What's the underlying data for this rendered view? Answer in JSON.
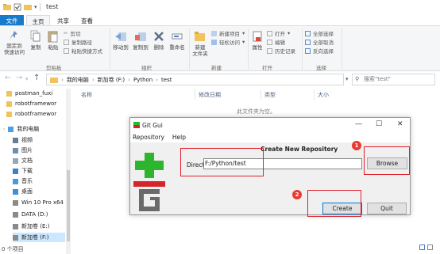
{
  "window": {
    "title": "test"
  },
  "ribbon_tabs": [
    "文件",
    "主页",
    "共享",
    "查看"
  ],
  "ribbon": {
    "clipboard": {
      "pin_label_1": "固定到",
      "pin_label_2": "快速访问",
      "copy": "复制",
      "paste": "粘贴",
      "cut": "剪切",
      "copy_path": "复制路径",
      "paste_shortcut": "粘贴快捷方式",
      "group": "剪贴板"
    },
    "organize": {
      "move_to": "移动到",
      "copy_to": "复制到",
      "delete": "删除",
      "rename": "重命名",
      "group": "组织"
    },
    "new": {
      "new_folder_1": "新建",
      "new_folder_2": "文件夹",
      "new_item": "新建项目",
      "easy_access": "轻松访问",
      "group": "新建"
    },
    "open": {
      "properties": "属性",
      "open": "打开",
      "edit": "编辑",
      "history": "历史记录",
      "group": "打开"
    },
    "select": {
      "select_all": "全部选择",
      "select_none": "全部取消",
      "invert": "反向选择",
      "group": "选择"
    }
  },
  "address": {
    "path": [
      "我的电脑",
      "新加卷 (F:)",
      "Python",
      "test"
    ],
    "search_placeholder": "搜索\"test\""
  },
  "nav": {
    "items": [
      {
        "label": "postman_fuxi",
        "icon": "folder-icon"
      },
      {
        "label": "robotframewor",
        "icon": "folder-icon"
      },
      {
        "label": "robotframewor",
        "icon": "folder-icon"
      },
      {
        "label": "我的电脑",
        "icon": "computer-icon"
      },
      {
        "label": "视频",
        "icon": "video-icon"
      },
      {
        "label": "图片",
        "icon": "pictures-icon"
      },
      {
        "label": "文档",
        "icon": "documents-icon"
      },
      {
        "label": "下载",
        "icon": "download-icon"
      },
      {
        "label": "音乐",
        "icon": "music-icon"
      },
      {
        "label": "桌面",
        "icon": "desktop-icon"
      },
      {
        "label": "Win 10 Pro x64",
        "icon": "drive-icon"
      },
      {
        "label": "DATA (D:)",
        "icon": "drive-icon"
      },
      {
        "label": "新加卷 (E:)",
        "icon": "drive-icon"
      },
      {
        "label": "新加卷 (F:)",
        "icon": "drive-icon"
      }
    ]
  },
  "columns": [
    "名称",
    "修改日期",
    "类型",
    "大小"
  ],
  "empty_message": "此文件夹为空。",
  "status": "0 个项目",
  "git_gui": {
    "title": "Git Gui",
    "menu": [
      "Repository",
      "Help"
    ],
    "heading": "Create New Repository",
    "directory_label": "Directory:",
    "directory_value": "F:/Python/test",
    "browse": "Browse",
    "create": "Create",
    "quit": "Quit"
  },
  "annotations": [
    "1",
    "2"
  ],
  "colors": {
    "accent": "#1979ca",
    "annotation": "#e0202a",
    "git_green": "#2db52d",
    "git_red": "#d4262a"
  }
}
